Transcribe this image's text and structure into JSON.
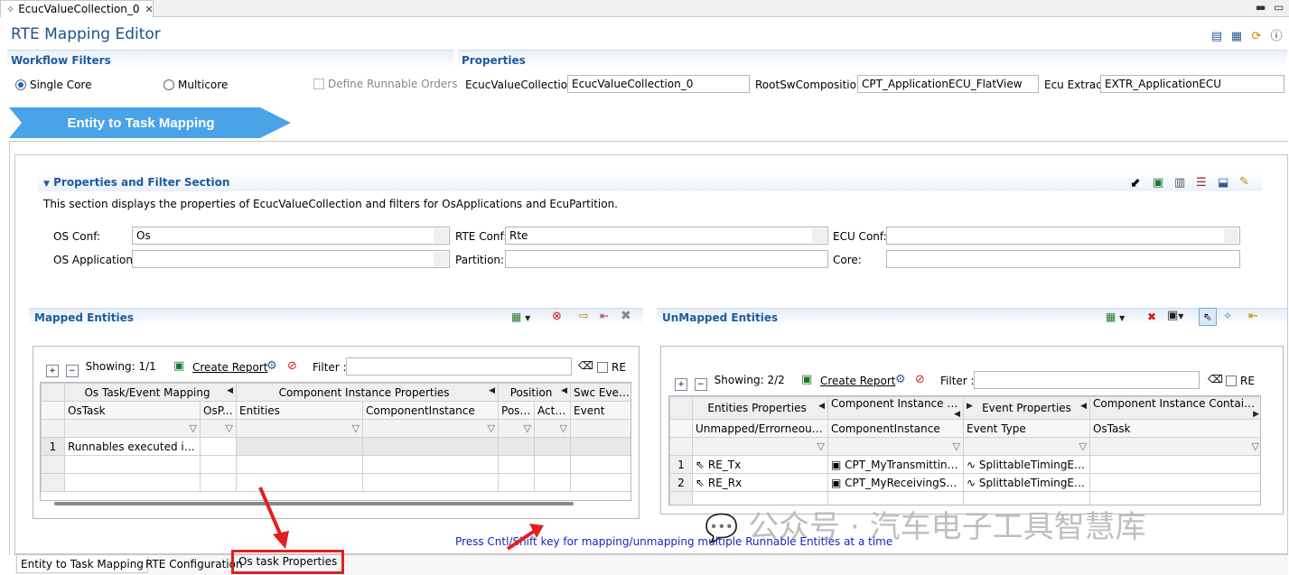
{
  "editor_tab": {
    "label": "EcucValueCollection_0"
  },
  "editor": {
    "title": "RTE Mapping Editor",
    "workflow_filters": {
      "title": "Workflow Filters",
      "single_core": "Single Core",
      "multicore": "Multicore",
      "define_runnable_orders": "Define Runnable Orders"
    },
    "properties": {
      "title": "Properties",
      "ecuc_label": "EcucValueCollection",
      "ecuc_value": "EcucValueCollection_0",
      "root_label": "RootSwComposition",
      "root_value": "CPT_ApplicationECU_FlatView",
      "ecu_label": "Ecu Extract",
      "ecu_value": "EXTR_ApplicationECU"
    },
    "banner": "Entity to Task Mapping"
  },
  "filter_section": {
    "title": "Properties and Filter Section",
    "description": "This section displays the properties of EcucValueCollection and filters for OsApplications and EcuPartition.",
    "os_conf_label": "OS Conf:",
    "os_conf_value": "Os",
    "rte_conf_label": "RTE Conf:",
    "rte_conf_value": "Rte",
    "ecu_conf_label": "ECU Conf:",
    "ecu_conf_value": "",
    "os_app_label": "OS Application:",
    "partition_label": "Partition:",
    "core_label": "Core:"
  },
  "mapped": {
    "title": "Mapped Entities",
    "showing": "Showing: 1/1",
    "create_report": "Create Report",
    "filter_label": "Filter :",
    "re_label": "RE",
    "group_headers": [
      "Os Task/Event Mapping",
      "Component Instance Properties",
      "Position",
      "Swc Event Pr"
    ],
    "columns": [
      "OsTask",
      "OsP...",
      "Entities",
      "ComponentInstance",
      "Posi...",
      "Acti...",
      "Event"
    ],
    "rows": [
      {
        "num": "1",
        "cells": [
          "Runnables executed in ...",
          "",
          "",
          "",
          "",
          "",
          ""
        ]
      }
    ]
  },
  "unmapped": {
    "title": "UnMapped Entities",
    "showing": "Showing: 2/2",
    "create_report": "Create Report",
    "filter_label": "Filter :",
    "re_label": "RE",
    "group_headers": [
      "Entities Properties",
      "Component Instance Pr...",
      "Event Properties",
      "Component Instance Contain..."
    ],
    "columns": [
      "Unmapped/Errorneous E...",
      "ComponentInstance",
      "Event Type",
      "OsTask"
    ],
    "rows": [
      {
        "num": "1",
        "cells": [
          "RE_Tx",
          "CPT_MyTransmittingS...",
          "SplittableTimingEvent",
          ""
        ]
      },
      {
        "num": "2",
        "cells": [
          "RE_Rx",
          "CPT_MyReceivingSW...",
          "SplittableTimingEvent",
          ""
        ]
      }
    ]
  },
  "hint": "Press Cntl/Shift key for mapping/unmapping multiple Runnable Entities at a time",
  "bottom_tabs": [
    "Entity to Task Mapping",
    "RTE Configuration",
    "Os task Properties"
  ],
  "watermark": "公众号 · 汽车电子工具智慧库",
  "colors": {
    "accent": "#1f5aa0",
    "banner": "#4aa3e6",
    "highlight": "#e02020"
  }
}
